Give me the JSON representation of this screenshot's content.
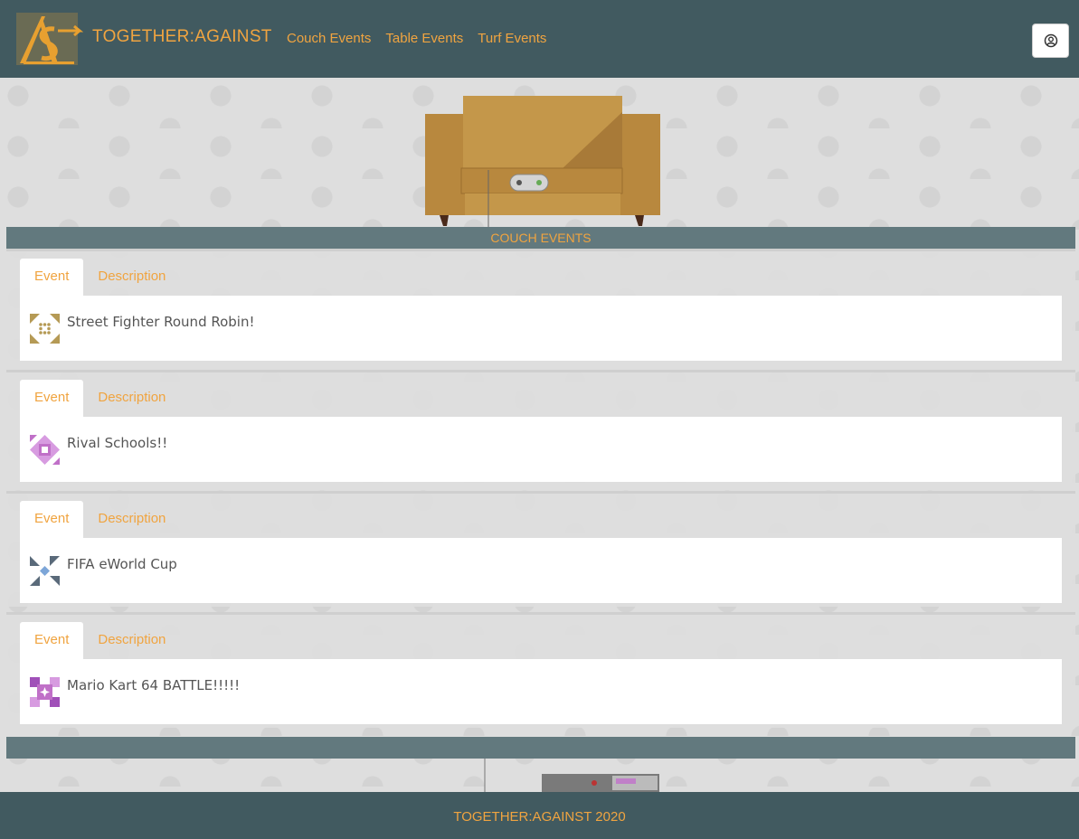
{
  "header": {
    "brand": "TOGETHER:AGAINST",
    "nav": [
      "Couch Events",
      "Table Events",
      "Turf Events"
    ]
  },
  "section": {
    "title": "COUCH EVENTS"
  },
  "tabs": {
    "event": "Event",
    "description": "Description"
  },
  "events": [
    {
      "name": "Street Fighter Round Robin!",
      "avatar_color": "#b59a55"
    },
    {
      "name": "Rival Schools!!",
      "avatar_color": "#c070c8"
    },
    {
      "name": "FIFA eWorld Cup",
      "avatar_color": "#5a6a7a"
    },
    {
      "name": "Mario Kart 64 BATTLE!!!!!",
      "avatar_color": "#a050b8"
    }
  ],
  "footer": {
    "text": "TOGETHER:AGAINST 2020"
  },
  "colors": {
    "header_bg": "#415a60",
    "accent": "#f0a440",
    "section_bar": "#62797e"
  }
}
